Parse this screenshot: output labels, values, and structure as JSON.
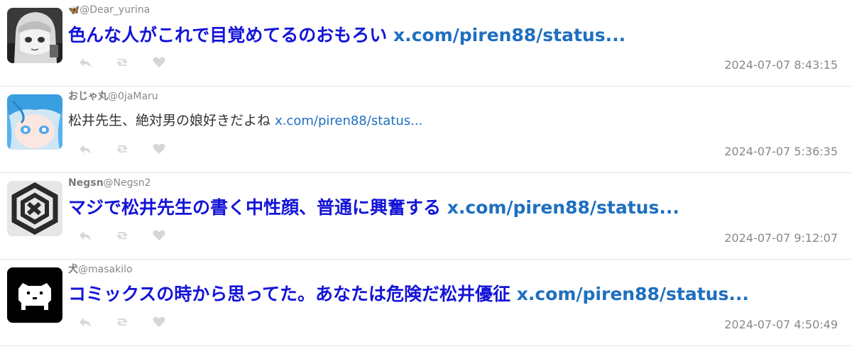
{
  "tweets": [
    {
      "display_name": "",
      "emoji": "🦋",
      "handle": "@Dear_yurina",
      "text": "色んな人がこれで目覚めてるのおもろい",
      "link": "x.com/piren88/status...",
      "timestamp": "2024-07-07 8:43:15",
      "style": "big"
    },
    {
      "display_name": "おじゃ丸",
      "emoji": "",
      "handle": "@0jaMaru",
      "text": "松井先生、絶対男の娘好きだよね",
      "link": "x.com/piren88/status...",
      "timestamp": "2024-07-07 5:36:35",
      "style": "small"
    },
    {
      "display_name": "Negsn",
      "emoji": "",
      "handle": "@Negsn2",
      "text": "マジで松井先生の書く中性顔、普通に興奮する",
      "link": "x.com/piren88/status...",
      "timestamp": "2024-07-07 9:12:07",
      "style": "big"
    },
    {
      "display_name": "犬",
      "emoji": "",
      "handle": "@masakilo",
      "text": "コミックスの時から思ってた。あなたは危険だ松井優征",
      "link": "x.com/piren88/status...",
      "timestamp": "2024-07-07 4:50:49",
      "style": "big"
    }
  ],
  "icons": {
    "reply": "reply-icon",
    "retweet": "retweet-icon",
    "like": "heart-icon"
  },
  "colors": {
    "big_text": "#1414d8",
    "link": "#1f6fbf",
    "icon": "#d6d6d6",
    "timestamp": "#888888"
  }
}
